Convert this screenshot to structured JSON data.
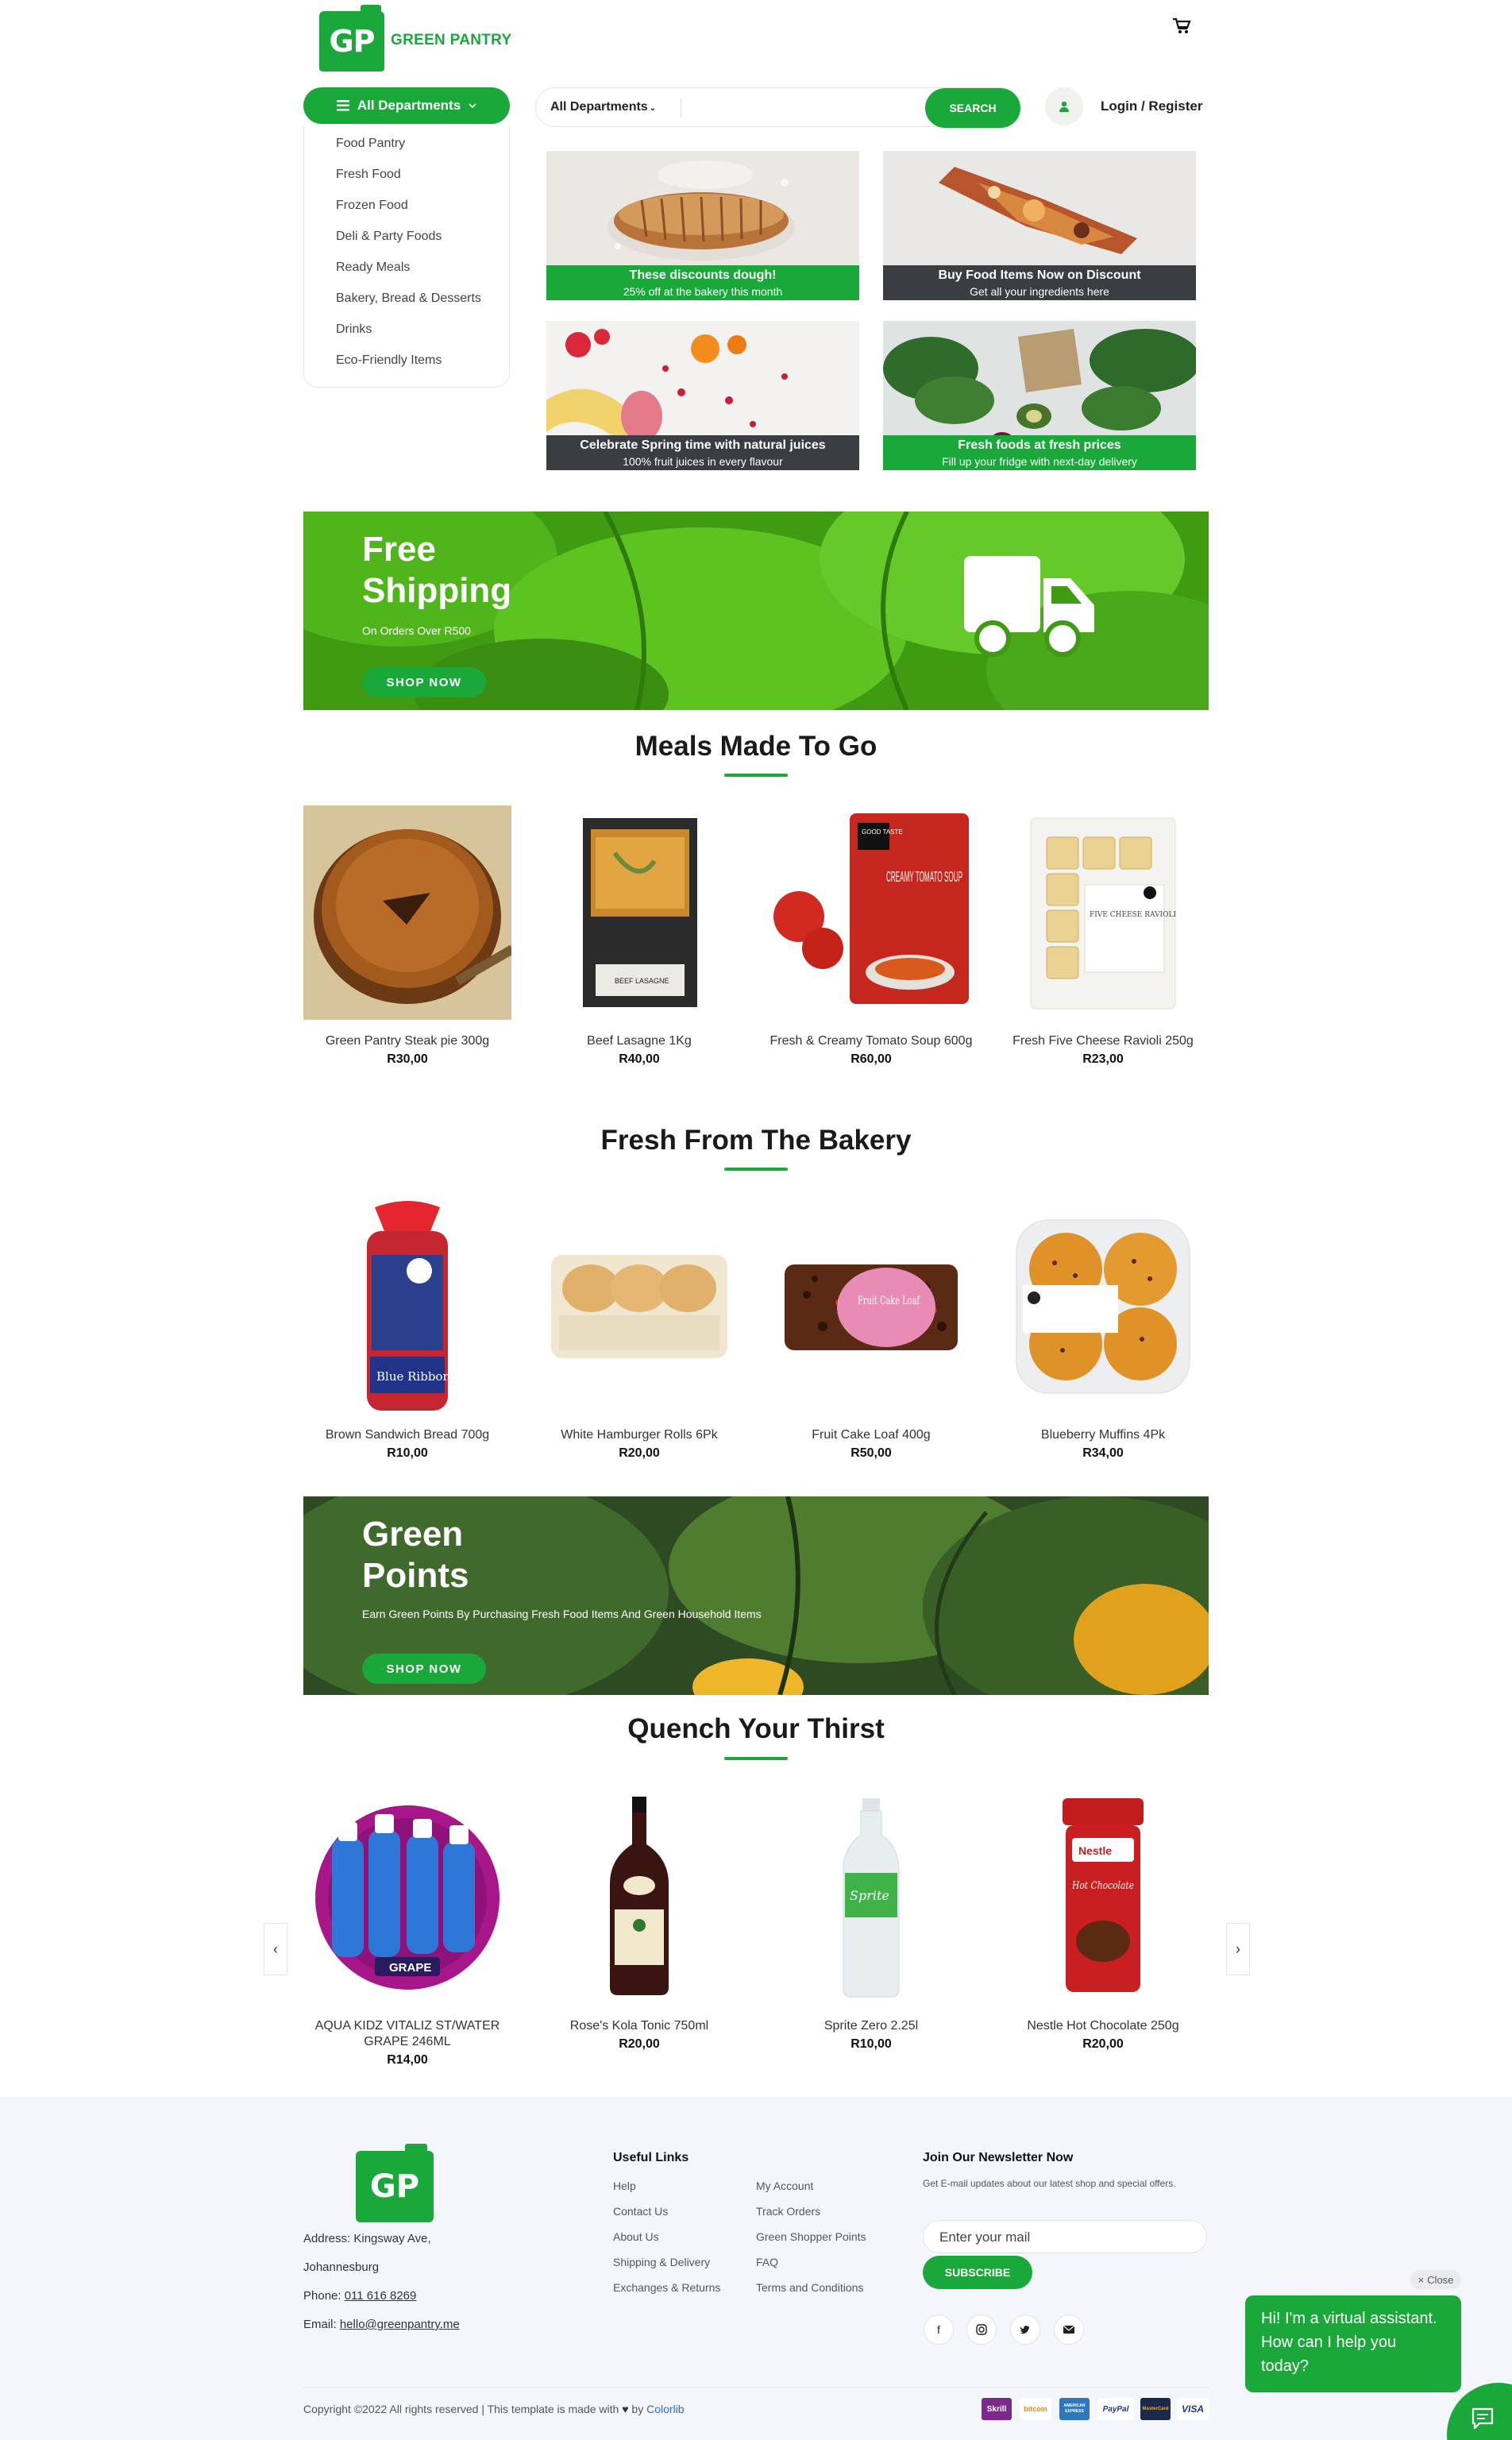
{
  "header": {
    "logo_initials": "GP",
    "brand_name": "GREEN PANTRY",
    "login_label": "Login / Register"
  },
  "departments": {
    "button_label": "All Departments",
    "items": [
      {
        "label": "Food Pantry"
      },
      {
        "label": "Fresh Food"
      },
      {
        "label": "Frozen Food"
      },
      {
        "label": "Deli & Party Foods"
      },
      {
        "label": "Ready Meals"
      },
      {
        "label": "Bakery, Bread & Desserts"
      },
      {
        "label": "Drinks"
      },
      {
        "label": "Eco-Friendly Items"
      }
    ]
  },
  "search": {
    "category": "All Departments",
    "placeholder": "",
    "button_label": "SEARCH"
  },
  "promos": [
    {
      "title": "These discounts dough!",
      "subtitle": "25% off at the bakery this month"
    },
    {
      "title": "Buy Food Items Now on Discount",
      "subtitle": "Get all your ingredients here"
    },
    {
      "title": "Celebrate Spring time with natural juices",
      "subtitle": "100% fruit juices in every flavour"
    },
    {
      "title": "Fresh foods at fresh prices",
      "subtitle": "Fill up your fridge with next-day delivery"
    }
  ],
  "banner_shipping": {
    "title_line1": "Free",
    "title_line2": "Shipping",
    "subtitle": "On Orders Over R500",
    "button": "SHOP NOW"
  },
  "sections": {
    "meals": {
      "title": "Meals Made To Go",
      "products": [
        {
          "name": "Green Pantry Steak pie 300g",
          "price": "R30,00"
        },
        {
          "name": "Beef Lasagne 1Kg",
          "price": "R40,00"
        },
        {
          "name": "Fresh & Creamy Tomato Soup 600g",
          "price": "R60,00"
        },
        {
          "name": "Fresh Five Cheese Ravioli 250g",
          "price": "R23,00"
        }
      ]
    },
    "bakery": {
      "title": "Fresh From The Bakery",
      "products": [
        {
          "name": "Brown Sandwich Bread 700g",
          "price": "R10,00"
        },
        {
          "name": "White Hamburger Rolls 6Pk",
          "price": "R20,00"
        },
        {
          "name": "Fruit Cake Loaf 400g",
          "price": "R50,00"
        },
        {
          "name": "Blueberry Muffins 4Pk",
          "price": "R34,00"
        }
      ]
    },
    "drinks": {
      "title": "Quench Your Thirst",
      "products": [
        {
          "name": "AQUA KIDZ VITALIZ ST/WATER GRAPE 246ML",
          "price": "R14,00"
        },
        {
          "name": "Rose's Kola Tonic 750ml",
          "price": "R20,00"
        },
        {
          "name": "Sprite Zero 2.25l",
          "price": "R10,00"
        },
        {
          "name": "Nestle Hot Chocolate 250g",
          "price": "R20,00"
        }
      ]
    }
  },
  "banner_points": {
    "title_line1": "Green",
    "title_line2": "Points",
    "subtitle": "Earn Green Points By Purchasing Fresh Food Items And Green Household Items",
    "button": "SHOP NOW"
  },
  "product_image_labels": {
    "soup_brand": "GOOD TASTE",
    "soup_name": "CREAMY TOMATO SOUP",
    "lasagne": "BEEF LASAGNE",
    "ravioli": "FIVE CHEESE RAVIOLI",
    "bread": "Blue Ribbon",
    "cake": "Fruit Cake Loaf",
    "water": "GRAPE",
    "sprite": "Sprite",
    "nestle": "Nestle",
    "hot_choc": "Hot Chocolate"
  },
  "footer": {
    "logo_initials": "GP",
    "address": "Address: Kingsway Ave,",
    "city": "Johannesburg",
    "phone_label": "Phone: ",
    "phone": "011 616 8269",
    "email_label": "Email: ",
    "email": "hello@greenpantry.me",
    "useful_links_title": "Useful Links",
    "links_col1": [
      "Help",
      "Contact Us",
      "About Us",
      "Shipping & Delivery",
      "Exchanges & Returns"
    ],
    "links_col2": [
      "My Account",
      "Track Orders",
      "Green Shopper Points",
      "FAQ",
      "Terms and Conditions"
    ],
    "newsletter_title": "Join Our Newsletter Now",
    "newsletter_text": "Get E-mail updates about our latest shop and special offers.",
    "email_placeholder": "Enter your mail",
    "subscribe": "SUBSCRIBE",
    "copyright": "Copyright ©2022 All rights reserved | This template is made with",
    "by": "by",
    "credit": "Colorlib",
    "payments": [
      "Skrill",
      "bitcoin",
      "AMERICAN EXPRESS",
      "PayPal",
      "MasterCard",
      "VISA"
    ]
  },
  "chat": {
    "close_label": "Close",
    "message": "Hi! I'm a virtual assistant. How can I help you today?"
  },
  "colors": {
    "brand_green": "#1aa83a",
    "dark_caption": "#3a3d42",
    "footer_bg": "#f3f6fb"
  }
}
